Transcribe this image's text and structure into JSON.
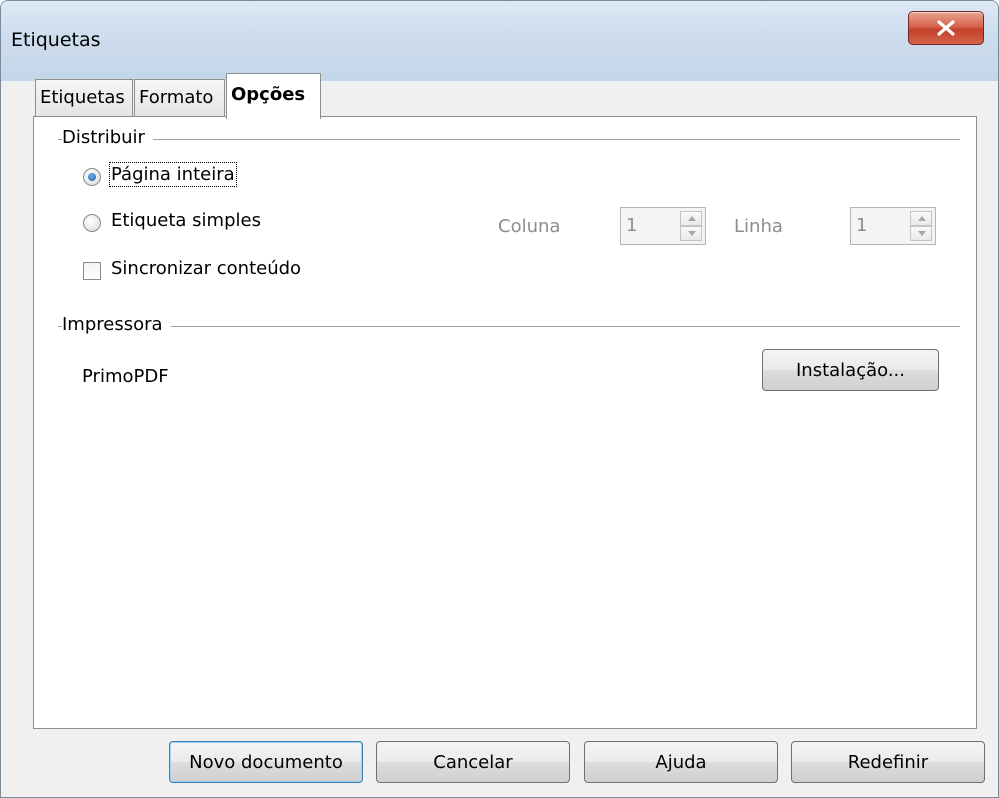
{
  "window": {
    "title": "Etiquetas"
  },
  "tabs": [
    {
      "label": "Etiquetas",
      "active": false
    },
    {
      "label": "Formato",
      "active": false
    },
    {
      "label": "Opções",
      "active": true
    }
  ],
  "distribute": {
    "section_label": "Distribuir",
    "full_page_label": "Página inteira",
    "single_label": "Etiqueta simples",
    "sync_label": "Sincronizar conteúdo",
    "column_label": "Coluna",
    "column_value": "1",
    "row_label": "Linha",
    "row_value": "1"
  },
  "printer": {
    "section_label": "Impressora",
    "name": "PrimoPDF",
    "setup_button": "Instalação..."
  },
  "footer": {
    "new_document": "Novo documento",
    "cancel": "Cancelar",
    "help": "Ajuda",
    "reset": "Redefinir"
  },
  "colors": {
    "accent": "#1c5aa8",
    "close_button": "#c4402a",
    "disabled_text": "#8d8d8d"
  }
}
